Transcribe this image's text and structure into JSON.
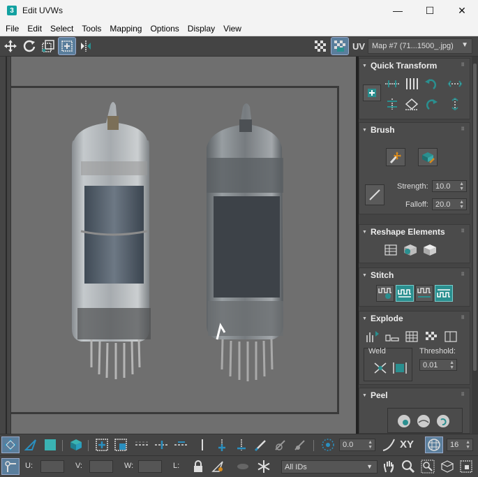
{
  "window": {
    "title": "Edit UVWs",
    "app_icon": "3",
    "minimize": "—",
    "maximize": "☐",
    "close": "✕"
  },
  "menu": [
    "File",
    "Edit",
    "Select",
    "Tools",
    "Mapping",
    "Options",
    "Display",
    "View"
  ],
  "toolbar": {
    "uv_label": "UV",
    "map_select": "Map #7 (71...1500_.jpg)"
  },
  "panel": {
    "quick_transform": "Quick Transform",
    "brush": "Brush",
    "strength_label": "Strength:",
    "strength_value": "10.0",
    "falloff_label": "Falloff:",
    "falloff_value": "20.0",
    "reshape": "Reshape Elements",
    "stitch": "Stitch",
    "explode": "Explode",
    "weld_label": "Weld",
    "threshold_label": "Threshold:",
    "threshold_value": "0.01",
    "peel": "Peel"
  },
  "bottom": {
    "spin_value": "0.0",
    "xy_label": "XY",
    "grid_value": "16",
    "u_label": "U:",
    "v_label": "V:",
    "w_label": "W:",
    "l_label": "L:",
    "ids_select": "All IDs"
  },
  "colors": {
    "accent": "#2a8f8f",
    "highlight": "#5a7e9c",
    "bg": "#444444",
    "viewport": "#6f6f6f"
  }
}
